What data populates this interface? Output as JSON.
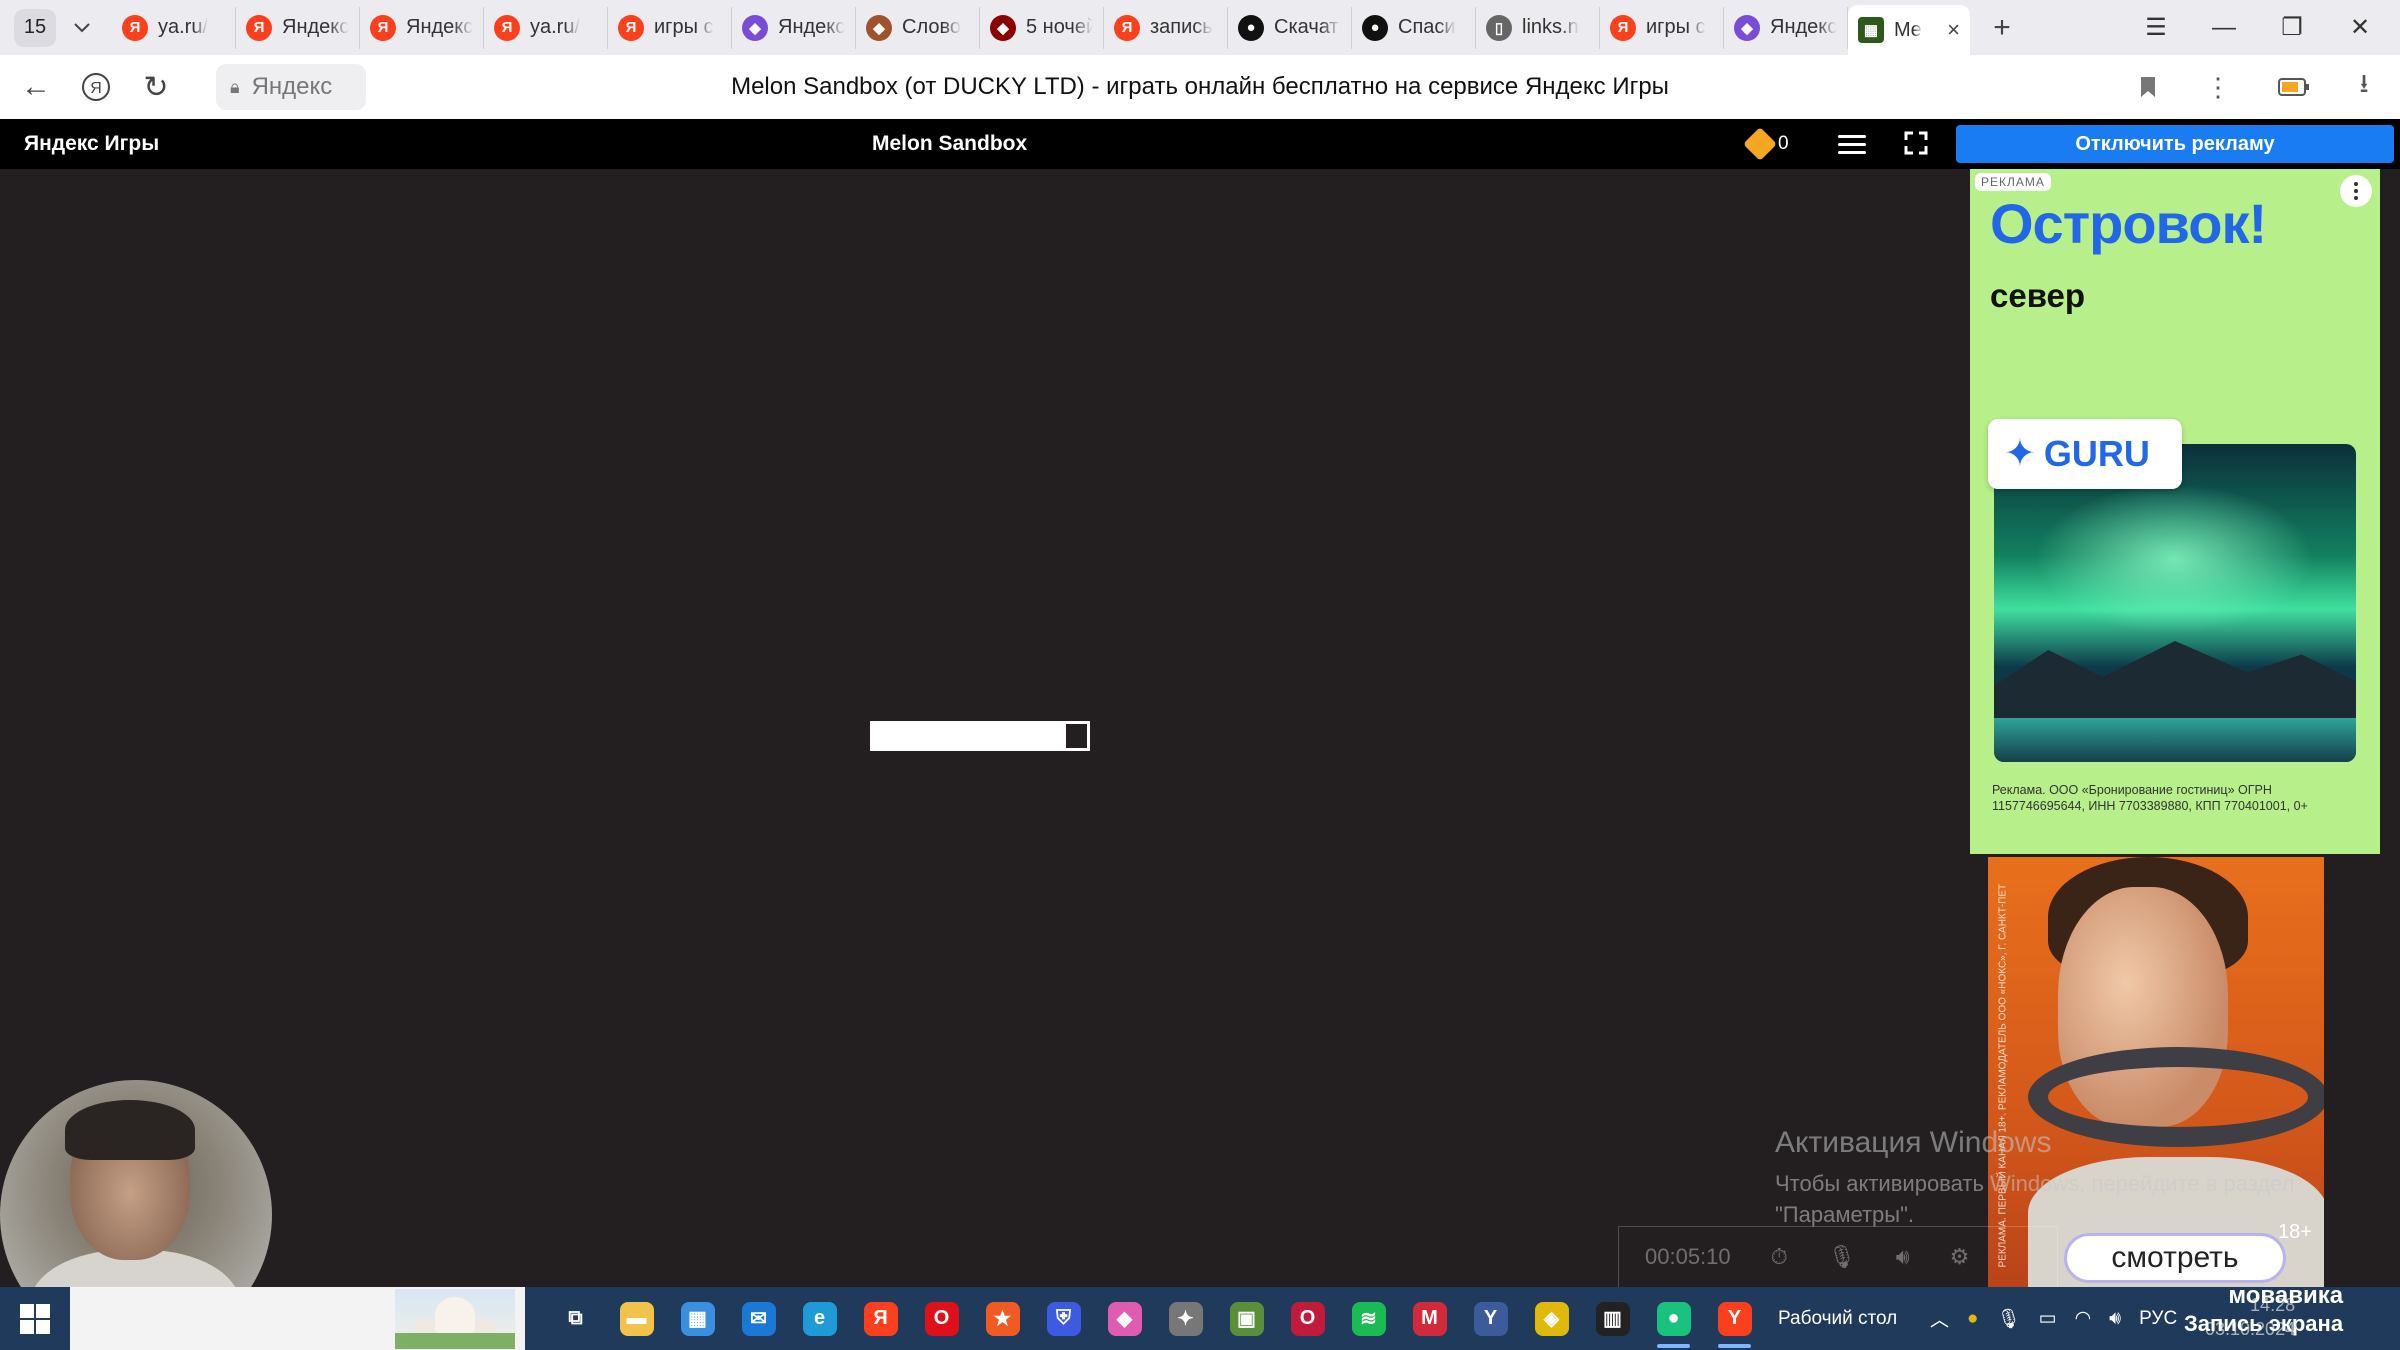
{
  "browser": {
    "tab_count": "15",
    "tabs": [
      {
        "title": "ya.ru/",
        "icon": "yandex-favicon",
        "color": "#fc3f1d"
      },
      {
        "title": "Яндекс",
        "icon": "yandex-favicon",
        "color": "#fc3f1d"
      },
      {
        "title": "Яндекс",
        "icon": "yandex-favicon",
        "color": "#fc3f1d"
      },
      {
        "title": "ya.ru/",
        "icon": "yandex-favicon",
        "color": "#fc3f1d"
      },
      {
        "title": "игры с",
        "icon": "yandex-favicon",
        "color": "#fc3f1d"
      },
      {
        "title": "Яндекс",
        "icon": "game-favicon",
        "color": "#7a4bd6"
      },
      {
        "title": "Слово",
        "icon": "game-favicon",
        "color": "#a0522d"
      },
      {
        "title": "5 ночей",
        "icon": "game-favicon",
        "color": "#8b0000"
      },
      {
        "title": "запись",
        "icon": "yandex-favicon",
        "color": "#fc3f1d"
      },
      {
        "title": "Скачать",
        "icon": "steam-favicon",
        "color": "#111111"
      },
      {
        "title": "Спаси",
        "icon": "steam-favicon",
        "color": "#111111"
      },
      {
        "title": "links.n",
        "icon": "page-favicon",
        "color": "#666666"
      },
      {
        "title": "игры с",
        "icon": "yandex-favicon",
        "color": "#fc3f1d"
      },
      {
        "title": "Яндекс",
        "icon": "game-favicon",
        "color": "#7a4bd6"
      }
    ],
    "active_tab": {
      "title": "Me",
      "icon": "melon-favicon"
    },
    "address_text": "Яндекс",
    "page_title": "Melon Sandbox (от DUCKY LTD) - играть онлайн бесплатно на сервисе Яндекс Игры"
  },
  "game_header": {
    "brand": "Яндекс Игры",
    "title": "Melon Sandbox",
    "coins": "0",
    "disable_ads": "Отключить рекламу"
  },
  "loader": {
    "progress": 0.9
  },
  "ad1": {
    "label": "РЕКЛАМА",
    "brand": "Островок!",
    "subtitle": "север",
    "badge": "GURU",
    "legal": "Реклама. ООО «Бронирование гостиниц» ОГРН 1157746695644, ИНН 7703389880, КПП 770401001, 0+"
  },
  "ad2": {
    "button": "смотреть",
    "age": "18+",
    "side_text": "РЕКЛАМА. ПЕРВЫЙ КАНАЛ 18+. РЕКЛАМОДАТЕЛЬ ООО «НОКС», Г. САНКТ-ПЕТ"
  },
  "windows_activation": {
    "line1": "Активация Windows",
    "line2": "Чтобы активировать Windows, перейдите в раздел",
    "line3": "\"Параметры\"."
  },
  "recorder": {
    "time": "00:05:10"
  },
  "watermark": {
    "line1": "мовавика",
    "line2": "Запись экрана"
  },
  "taskbar": {
    "desktop_label": "Рабочий стол",
    "language": "РУС",
    "time": "14:28",
    "date": "03.10.2024",
    "apps": [
      {
        "name": "task-view",
        "glyph": "⧉",
        "color": "#1f3a5a"
      },
      {
        "name": "file-explorer",
        "glyph": "▬",
        "color": "#f2c34a"
      },
      {
        "name": "ms-store",
        "glyph": "▦",
        "color": "#3a8fe0"
      },
      {
        "name": "mail",
        "glyph": "✉",
        "color": "#1b78d4"
      },
      {
        "name": "edge",
        "glyph": "e",
        "color": "#1e9bd7"
      },
      {
        "name": "yandex",
        "glyph": "Я",
        "color": "#fc3f1d"
      },
      {
        "name": "opera",
        "glyph": "O",
        "color": "#e0101a"
      },
      {
        "name": "brave",
        "glyph": "★",
        "color": "#f25a24"
      },
      {
        "name": "shield-app",
        "glyph": "⛨",
        "color": "#3d5be0"
      },
      {
        "name": "game-app",
        "glyph": "◆",
        "color": "#e05cb0"
      },
      {
        "name": "star-app",
        "glyph": "✦",
        "color": "#777777"
      },
      {
        "name": "minecraft",
        "glyph": "▣",
        "color": "#5a8f3a"
      },
      {
        "name": "opera-gx",
        "glyph": "O",
        "color": "#c21a3a"
      },
      {
        "name": "spotify",
        "glyph": "≋",
        "color": "#1db954"
      },
      {
        "name": "m-app",
        "glyph": "M",
        "color": "#d22a3a"
      },
      {
        "name": "y-app",
        "glyph": "Y",
        "color": "#3b5b9a"
      },
      {
        "name": "binance",
        "glyph": "◈",
        "color": "#e0b90b"
      },
      {
        "name": "stripe-app",
        "glyph": "▥",
        "color": "#222222"
      },
      {
        "name": "green-app",
        "glyph": "●",
        "color": "#19c37d"
      },
      {
        "name": "yandex-browser",
        "glyph": "Y",
        "color": "#fc3f1d"
      }
    ]
  }
}
